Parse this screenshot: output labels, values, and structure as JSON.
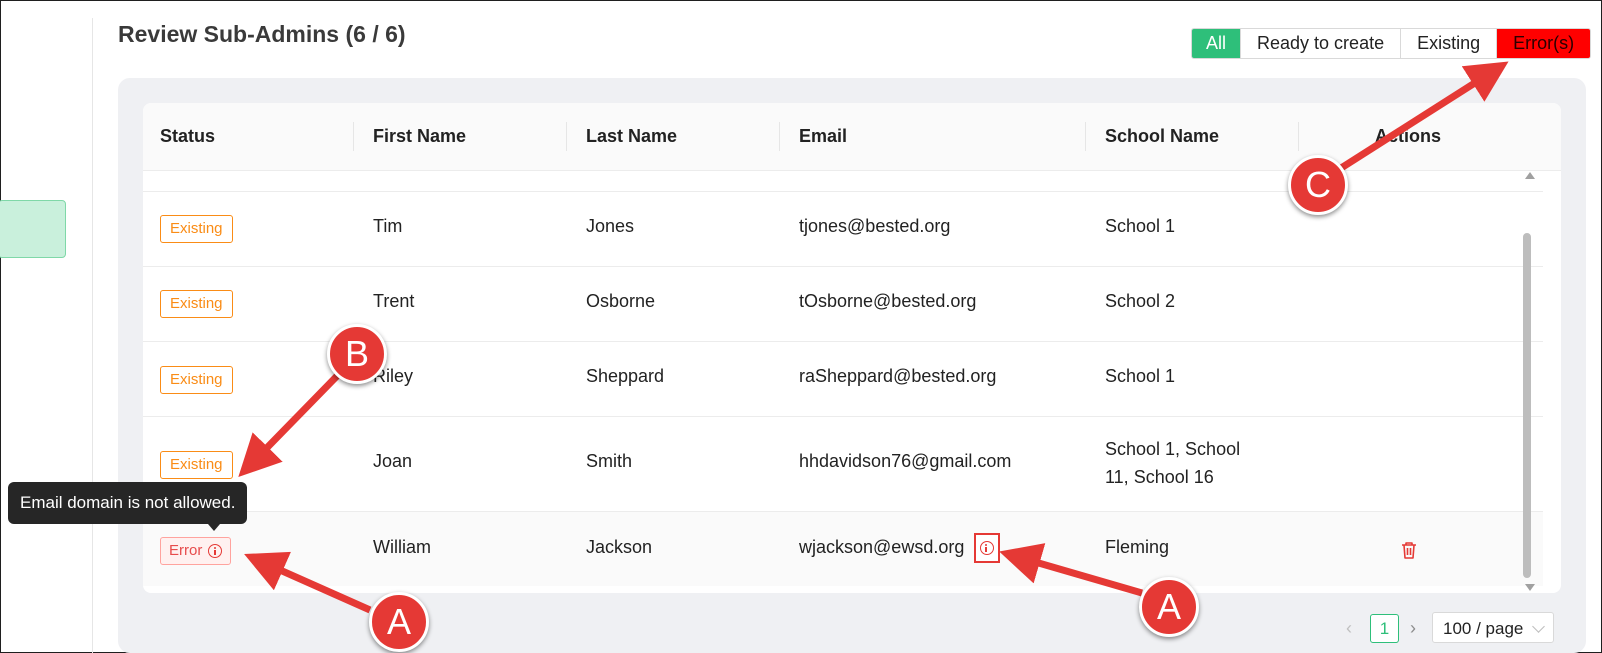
{
  "page": {
    "title": "Review Sub-Admins (6 / 6)"
  },
  "filters": {
    "all": "All",
    "ready": "Ready to create",
    "existing": "Existing",
    "errors": "Error(s)"
  },
  "table": {
    "headers": {
      "status": "Status",
      "first_name": "First Name",
      "last_name": "Last Name",
      "email": "Email",
      "school": "School Name",
      "actions": "Actions"
    },
    "rows": [
      {
        "status": "Existing",
        "first_name": "Tim",
        "last_name": "Jones",
        "email": "tjones@bested.org",
        "school": "School 1"
      },
      {
        "status": "Existing",
        "first_name": "Trent",
        "last_name": "Osborne",
        "email": "tOsborne@bested.org",
        "school": "School 2"
      },
      {
        "status": "Existing",
        "first_name": "Riley",
        "last_name": "Sheppard",
        "email": "raSheppard@bested.org",
        "school": "School 1"
      },
      {
        "status": "Existing",
        "first_name": "Joan",
        "last_name": "Smith",
        "email": "hhdavidson76@gmail.com",
        "school_line1": "School 1, School",
        "school_line2": "11, School 16"
      },
      {
        "status": "Error",
        "first_name": "William",
        "last_name": "Jackson",
        "email": "wjackson@ewsd.org",
        "school": "Fleming"
      }
    ]
  },
  "tooltip": {
    "text": "Email domain is not allowed."
  },
  "pagination": {
    "current_page": "1",
    "page_size": "100 / page"
  },
  "annotations": {
    "a": "A",
    "b": "B",
    "c": "C"
  },
  "colors": {
    "accent_green": "#2ebf7a",
    "error_red": "#ff0000",
    "existing_orange": "#fa8c16",
    "callout_red": "#e53935"
  }
}
